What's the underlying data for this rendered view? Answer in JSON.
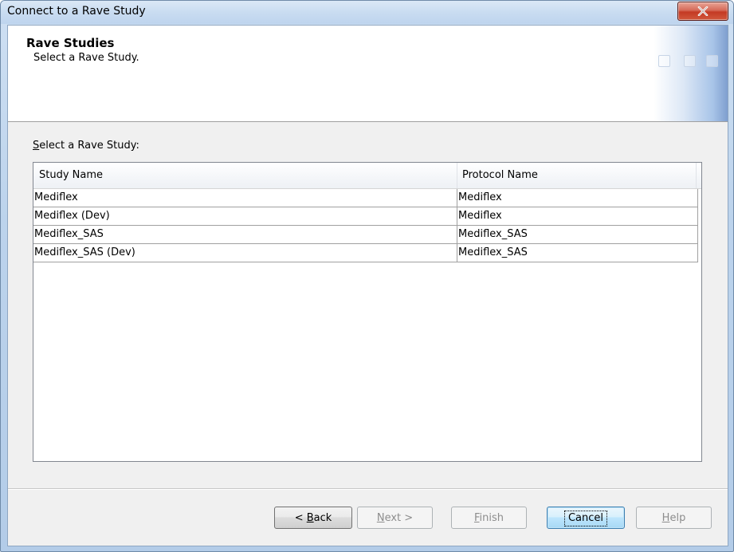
{
  "window": {
    "title": "Connect to a Rave Study",
    "close_glyph": "✕"
  },
  "header": {
    "title": "Rave Studies",
    "subtitle": "Select a Rave Study."
  },
  "list": {
    "label_prefix": "",
    "label_underline": "S",
    "label_rest": "elect a Rave Study:",
    "columns": [
      "Study Name",
      "Protocol Name"
    ],
    "rows": [
      [
        "Mediflex",
        "Mediflex"
      ],
      [
        "Mediflex (Dev)",
        "Mediflex"
      ],
      [
        "Mediflex_SAS",
        "Mediflex_SAS"
      ],
      [
        "Mediflex_SAS (Dev)",
        "Mediflex_SAS"
      ]
    ]
  },
  "buttons": {
    "back": {
      "prefix": "< ",
      "underline": "B",
      "rest": "ack"
    },
    "next": {
      "prefix": "",
      "underline": "N",
      "rest": "ext >"
    },
    "finish": {
      "prefix": "",
      "underline": "F",
      "rest": "inish"
    },
    "cancel": {
      "label": "Cancel"
    },
    "help": {
      "prefix": "",
      "underline": "H",
      "rest": "elp"
    }
  },
  "colors": {
    "window_frame": "#bcd3ec",
    "close_button": "#c43a24",
    "default_button_border": "#3c7fb1"
  }
}
